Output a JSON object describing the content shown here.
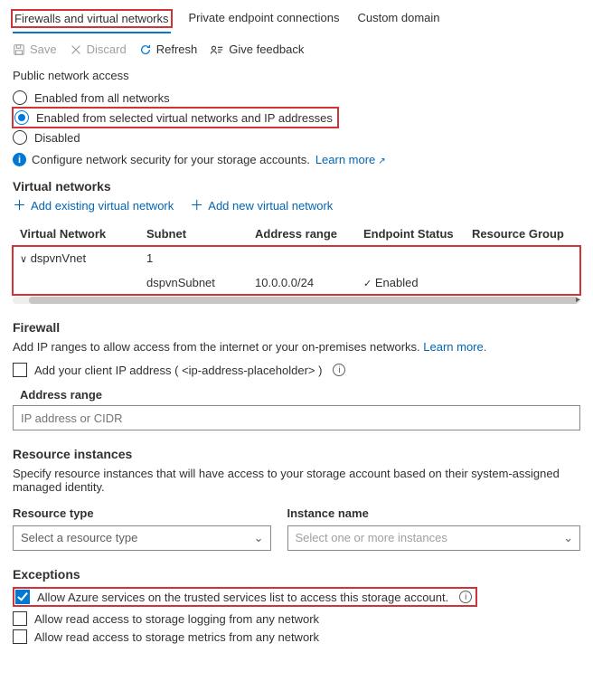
{
  "tabs": {
    "firewalls": "Firewalls and virtual networks",
    "pec": "Private endpoint connections",
    "domain": "Custom domain"
  },
  "toolbar": {
    "save": "Save",
    "discard": "Discard",
    "refresh": "Refresh",
    "feedback": "Give feedback"
  },
  "public_access": {
    "heading": "Public network access",
    "opt_all": "Enabled from all networks",
    "opt_selected": "Enabled from selected virtual networks and IP addresses",
    "opt_disabled": "Disabled",
    "info": "Configure network security for your storage accounts.",
    "learn": "Learn more"
  },
  "vnets": {
    "heading": "Virtual networks",
    "add_existing": "Add existing virtual network",
    "add_new": "Add new virtual network",
    "cols": {
      "vnet": "Virtual Network",
      "subnet": "Subnet",
      "range": "Address range",
      "status": "Endpoint Status",
      "rg": "Resource Group"
    },
    "row1": {
      "vnet": "dspvnVnet",
      "subnet": "1"
    },
    "row2": {
      "subnet": "dspvnSubnet",
      "range": "10.0.0.0/24",
      "status": "Enabled"
    }
  },
  "firewall": {
    "heading": "Firewall",
    "desc": "Add IP ranges to allow access from the internet or your on-premises networks.",
    "learn": "Learn more.",
    "client_ip_label": "Add your client IP address ( <ip-address-placeholder> )",
    "range_label": "Address range",
    "range_placeholder": "IP address or CIDR"
  },
  "resinst": {
    "heading": "Resource instances",
    "desc": "Specify resource instances that will have access to your storage account based on their system-assigned managed identity.",
    "type_label": "Resource type",
    "name_label": "Instance name",
    "type_placeholder": "Select a resource type",
    "name_placeholder": "Select one or more instances"
  },
  "exceptions": {
    "heading": "Exceptions",
    "trusted": "Allow Azure services on the trusted services list to access this storage account.",
    "logging": "Allow read access to storage logging from any network",
    "metrics": "Allow read access to storage metrics from any network"
  }
}
